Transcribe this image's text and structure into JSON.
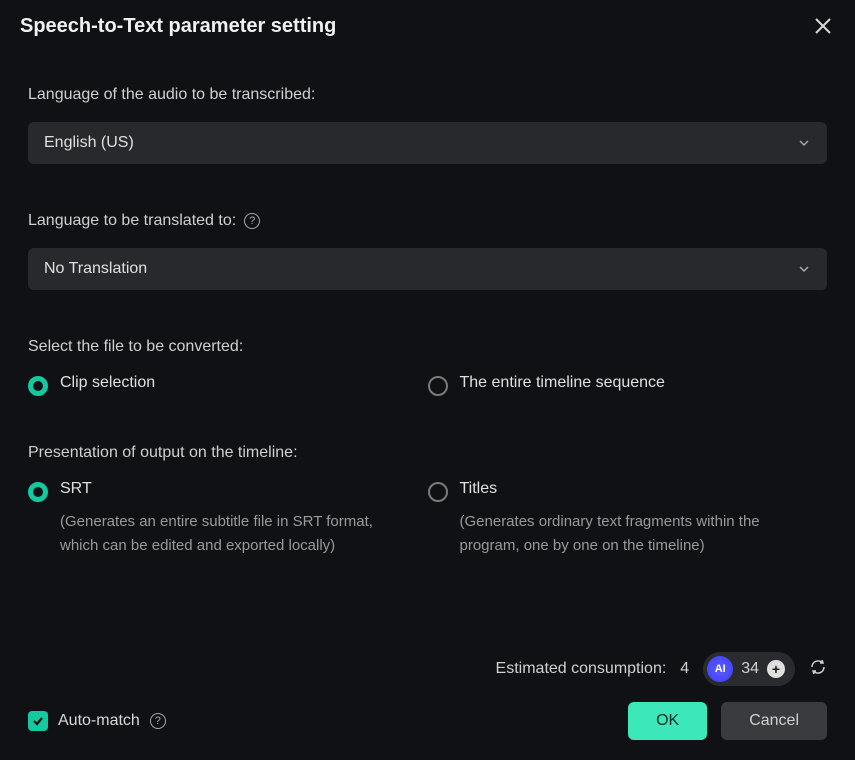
{
  "dialog": {
    "title": "Speech-to-Text parameter setting"
  },
  "audio_language": {
    "label": "Language of the audio to be transcribed:",
    "value": "English (US)"
  },
  "translate_language": {
    "label": "Language to be translated to:",
    "value": "No Translation"
  },
  "file_select": {
    "label": "Select the file to be converted:",
    "options": {
      "clip": "Clip selection",
      "timeline": "The entire timeline sequence"
    },
    "selected": "clip"
  },
  "presentation": {
    "label": "Presentation of output on the timeline:",
    "srt": {
      "title": "SRT",
      "desc": "(Generates an entire subtitle file in SRT format, which can be edited and exported locally)"
    },
    "titles": {
      "title": "Titles",
      "desc": "(Generates ordinary text fragments within the program, one by one on the timeline)"
    },
    "selected": "srt"
  },
  "consumption": {
    "label": "Estimated consumption:",
    "value": "4",
    "credit": "34"
  },
  "auto_match": {
    "label": "Auto-match",
    "checked": true
  },
  "buttons": {
    "ok": "OK",
    "cancel": "Cancel"
  }
}
